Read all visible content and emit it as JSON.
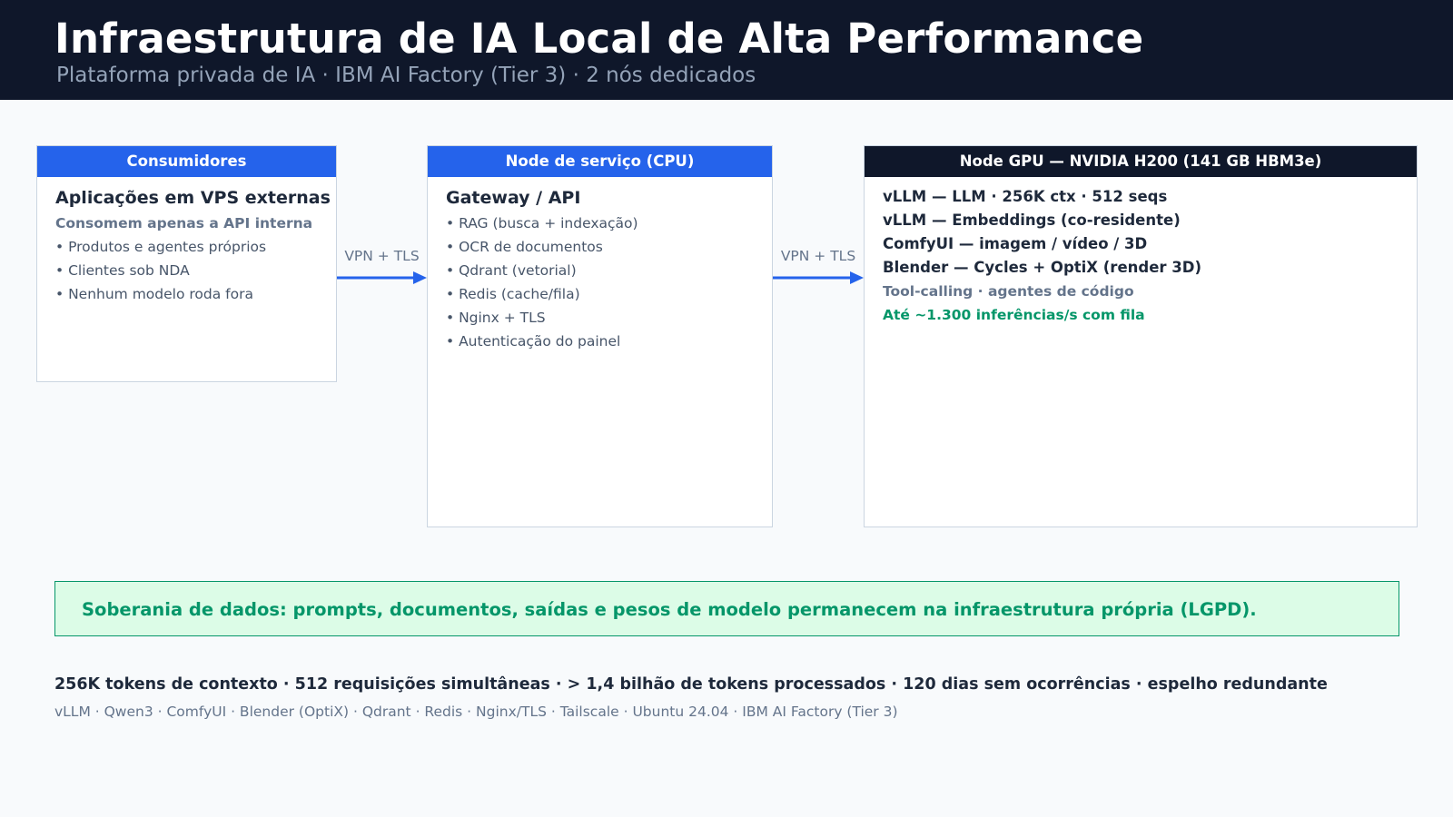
{
  "header": {
    "title": "Infraestrutura de IA Local de Alta Performance",
    "subtitle": "Plataforma privada de IA · IBM AI Factory (Tier 3) · 2 nós dedicados"
  },
  "colors": {
    "header_bg": "#0f172a",
    "accent_blue": "#2563eb",
    "accent_green": "#059669",
    "banner_bg": "#dcfce7"
  },
  "consumers": {
    "header": "Consumidores",
    "title": "Aplicações em VPS externas",
    "subtitle": "Consomem apenas a API interna",
    "items": [
      "• Produtos e agentes próprios",
      "• Clientes sob NDA",
      "• Nenhum modelo roda fora"
    ]
  },
  "connector1": {
    "label": "VPN + TLS"
  },
  "service": {
    "header": "Node de serviço (CPU)",
    "title": "Gateway / API",
    "items": [
      "• RAG (busca + indexação)",
      "• OCR de documentos",
      "• Qdrant (vetorial)",
      "• Redis (cache/fila)",
      "• Nginx + TLS",
      "• Autenticação do painel"
    ]
  },
  "connector2": {
    "label": "VPN + TLS"
  },
  "gpu": {
    "header": "Node GPU — NVIDIA H200 (141 GB HBM3e)",
    "lines": [
      "vLLM — LLM · 256K ctx · 512 seqs",
      "vLLM — Embeddings (co-residente)",
      "ComfyUI — imagem / vídeo / 3D",
      "Blender — Cycles + OptiX (render 3D)"
    ],
    "muted": "Tool-calling · agentes de código",
    "highlight": "Até ~1.300 inferências/s com fila"
  },
  "banner": {
    "text": "Soberania de dados: prompts, documentos, saídas e pesos de modelo permanecem na infraestrutura própria (LGPD)."
  },
  "footer": {
    "stats": "256K tokens de contexto · 512 requisições simultâneas · > 1,4 bilhão de tokens processados · 120 dias sem ocorrências · espelho redundante",
    "stack": "vLLM · Qwen3 · ComfyUI · Blender (OptiX) · Qdrant · Redis · Nginx/TLS · Tailscale · Ubuntu 24.04 · IBM AI Factory (Tier 3)"
  }
}
